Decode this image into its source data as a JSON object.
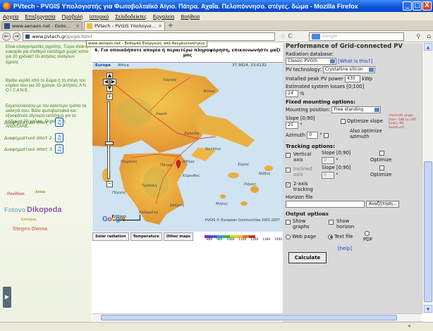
{
  "window": {
    "title": "PVtech - PVGIS Υπολογιστής για Φωτοβολταϊκό Αίγιο. Πάτρα. Αχαΐα. Πελοπόννησο. στέγες. δώμα - Mozilla Firefox",
    "buttons": [
      "_",
      "□",
      "X"
    ]
  },
  "menu": [
    "Αρχείο",
    "Επεξεργασία",
    "Προβολή",
    "Ιστορικό",
    "Σελιδοδείκτες",
    "Εργαλεία",
    "Βοήθεια"
  ],
  "tabs": [
    {
      "label": "www.aenaon.net - Εκπομπή Ενέργειας α...",
      "close": "×"
    },
    {
      "label": "PVtech - PVGIS Υπολογιστής για Φωτοβο...",
      "close": "×"
    }
  ],
  "newtab": "+",
  "nav": {
    "back": "←",
    "forward": "→",
    "url_host": "www.pvtech.gr",
    "url_path": "/pvgis.html",
    "tooltip": "www.aenaon.net - Εκπομπή Ενέργειας από Ανεμογεννήτριες",
    "search_placeholder": "Google",
    "star": "☆",
    "reload": "C",
    "home": "⌂"
  },
  "notice": "6. Για οποιαδήποτε απορία ή περαιτέρω πληροφόρηση, επικοινωνήστε μαζί μας",
  "left": {
    "intro": "Είναι επαγγελματίες αγρότης. Τώρα είναι η ευκαιρία για σταθερό εισόδημα χωρίς κόπο για 20 χρόνια!! Οι αιτήσεις ανοίγουν άμεσα.",
    "p2": "Βγάλε κερδή από το δώμα ή τη στέγη του κτιρίου σου για 20 χρόνια. Οι αιτήσεις Α Ν Ο Ι Ξ Α Ν Ε.",
    "p3": "Εκμεταλλεύσου με τον καλύτερο τρόπο τα ακίνητά σου. Βάλε φωτοβολταϊκά και εξασφάλισε σίγουρο εισόδημα για τα επόμενα 20 χρόνια. Οι αιτήσεις ΑΝΟΙΞΑΝΕ.",
    "downloads": [
      "Διαφημιστικό σποτ 1",
      "Διαφημιστικό σποτ 2",
      "Διαφημιστικό σποτ 3"
    ],
    "cloud": [
      "Pavillion",
      "Antea",
      "Dikopeda",
      "Fotovo",
      "Energeia",
      "Steges-Dwma"
    ]
  },
  "map": {
    "top_labels": [
      "Europa",
      "Africa"
    ],
    "coords": "37.9824, 23.6132",
    "places": [
      "Λάρισα",
      "Βόλος",
      "Λαμία",
      "Χαλκίδα",
      "Πάτρα",
      "Αθήνα",
      "Πειραιάς",
      "Κόρινθος",
      "Τρίπολη",
      "Καλαμάτα",
      "Σπάρτη",
      "Πύργος",
      "Ναύπλιο",
      "Πάρος",
      "Νάξος",
      "Μήλος",
      "Σύρος"
    ],
    "scale": "100 km",
    "google": "Google",
    "copyright": "PVGIS © European Communities 2001-2007",
    "legend_buttons": [
      "Solar radiation",
      "Temperature",
      "Other maps"
    ],
    "legend_ticks": [
      "800",
      "900",
      "1000",
      "1100",
      "1200",
      "1300",
      "1400"
    ],
    "legend_colors": [
      "#7d2fb6",
      "#3c5fd0",
      "#2fa4d8",
      "#41b05b",
      "#c6d62a",
      "#f2c230",
      "#e7792b",
      "#c8352a"
    ]
  },
  "form": {
    "title": "Performance of Grid-connected PV",
    "radiation_db_label": "Radiation database:",
    "radiation_db_value": "Classic PVGIS",
    "what_is_this": "[What is this?]",
    "pv_tech_label": "PV technology:",
    "pv_tech_value": "Crystalline silicon",
    "peak_power_label": "Installed peak PV power",
    "peak_power_value": "430",
    "peak_power_unit": "kWp",
    "losses_label": "Estimated system losses [0;100]",
    "losses_value": "14",
    "losses_unit": "%",
    "fixed_heading": "Fixed mounting options:",
    "mounting_label": "Mounting position:",
    "mounting_value": "Free standing",
    "slope_label": "Slope [0;90]",
    "slope_value": "25",
    "slope_unit": "°",
    "optimize_slope": "Optimize slope",
    "azimuth_note": "(Azimuth angle from -180 to 180. East=-90, South=0)",
    "azimuth_label": "Azimuth",
    "azimuth_value": "0",
    "also_optimize": "Also optimize azimuth",
    "tracking_heading": "Tracking options:",
    "vertical_axis": "Vertical axis",
    "inclined_axis": "Inclined axis",
    "slope_label2": "Slope [0;90]",
    "track_slope_value": "0",
    "optimize": "Optimize",
    "two_axis": "2-axis tracking",
    "horizon_label": "Horizon file",
    "browse": "Αναζήτηση...",
    "output_heading": "Output options",
    "show_graphs": "Show graphs",
    "show_horizon": "Show horizon",
    "web_page": "Web page",
    "text_file": "Text file",
    "pdf": "PDF",
    "help": "[help]",
    "calculate": "Calculate"
  }
}
